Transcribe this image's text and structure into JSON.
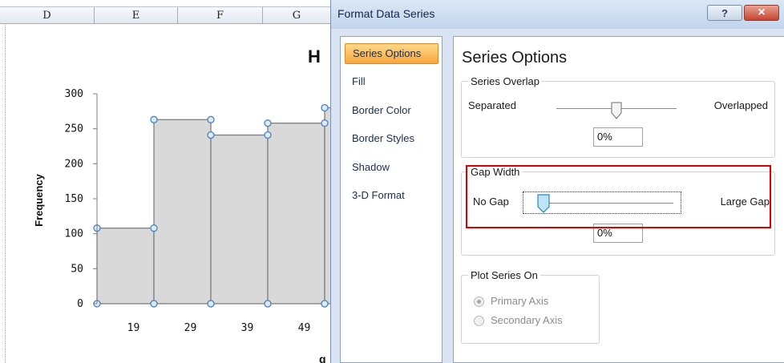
{
  "sheet": {
    "columns": [
      "D",
      "E",
      "F",
      "G"
    ],
    "chart_title_fragment": "H",
    "xaxis_title_fragment": "g"
  },
  "chart_data": {
    "type": "area",
    "ylabel": "Frequency",
    "xlabel": "",
    "ylim": [
      0,
      300
    ],
    "yticks": [
      0,
      50,
      100,
      150,
      200,
      250,
      300
    ],
    "categories": [
      "19",
      "29",
      "39",
      "49"
    ],
    "series": [
      {
        "values": [
          108,
          263,
          241,
          258,
          280
        ]
      }
    ],
    "colors": {
      "fill": "#d9d9d9",
      "stroke": "#7f7f7f",
      "marker": "#4f81bd"
    },
    "grid": false,
    "legend": "none"
  },
  "dialog": {
    "title": "Format Data Series",
    "help_icon": "?",
    "close_icon": "×",
    "nav_items": [
      "Series Options",
      "Fill",
      "Border Color",
      "Border Styles",
      "Shadow",
      "3-D Format"
    ],
    "selected_nav": "Series Options",
    "panel_title": "Series Options",
    "series_overlap": {
      "label": "Series Overlap",
      "left_label": "Separated",
      "right_label": "Overlapped",
      "value": "0%",
      "slider_position": 0.5
    },
    "gap_width": {
      "label": "Gap Width",
      "left_label": "No Gap",
      "right_label": "Large Gap",
      "value": "0%",
      "slider_position": 0.0
    },
    "plot_series_on": {
      "label": "Plot Series On",
      "primary": "Primary Axis",
      "secondary": "Secondary Axis",
      "selected": "primary"
    },
    "highlight_color": "#e00000"
  }
}
